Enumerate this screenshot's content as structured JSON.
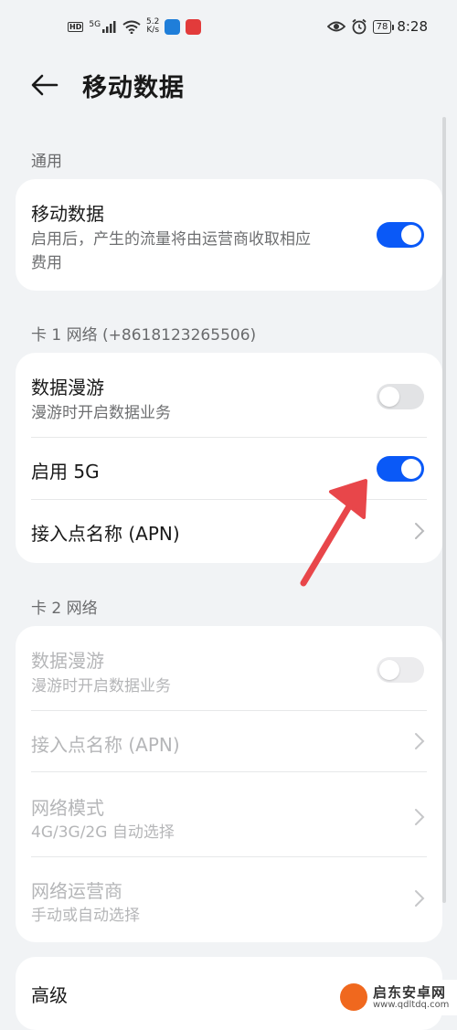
{
  "status_bar": {
    "hd_label": "HD",
    "signal_label": "5G",
    "speed_value": "5.2",
    "speed_unit": "K/s",
    "battery": "78",
    "time": "8:28"
  },
  "header": {
    "title": "移动数据"
  },
  "general": {
    "section_label": "通用",
    "mobile_data": {
      "title": "移动数据",
      "subtitle_line1": "启用后，产生的流量将由运营商收取相应",
      "subtitle_line2": "费用",
      "enabled": true
    }
  },
  "sim1": {
    "section_label": "卡 1 网络 (+8618123265506)",
    "roaming": {
      "title": "数据漫游",
      "subtitle": "漫游时开启数据业务",
      "enabled": false
    },
    "enable_5g": {
      "title": "启用 5G",
      "enabled": true
    },
    "apn": {
      "title": "接入点名称 (APN)"
    }
  },
  "sim2": {
    "section_label": "卡 2 网络",
    "roaming": {
      "title": "数据漫游",
      "subtitle": "漫游时开启数据业务",
      "enabled": false
    },
    "apn": {
      "title": "接入点名称 (APN)"
    },
    "network_mode": {
      "title": "网络模式",
      "subtitle": "4G/3G/2G 自动选择"
    },
    "carrier": {
      "title": "网络运营商",
      "subtitle": "手动或自动选择"
    }
  },
  "advanced": {
    "title": "高级"
  },
  "watermark": {
    "title": "启东安卓网",
    "url": "www.qdltdq.com"
  },
  "colors": {
    "accent": "#0a59f7",
    "annotation_arrow": "#e8464a",
    "background": "#f1f3f5"
  }
}
